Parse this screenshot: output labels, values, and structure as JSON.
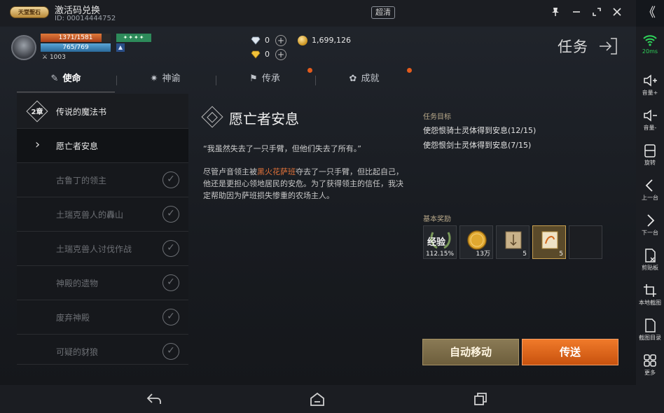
{
  "topbar": {
    "badge": "天堂聖石",
    "title": "激活码兑换",
    "id": "ID: 00014444752",
    "quality": "超清",
    "controls": [
      "pin-icon",
      "minimize-icon",
      "restore-icon",
      "close-icon"
    ],
    "collapse": "《"
  },
  "player": {
    "hp": "1371/1581",
    "hp_fraction": 0.867,
    "mp": "765/769",
    "mp_fraction": 0.995,
    "power": "1003",
    "power_icon": "crossed-swords-icon"
  },
  "currency": {
    "diamond_count": "0",
    "yellow_gem_count": "0",
    "gold": "1,699,126"
  },
  "screen_title": "任务",
  "tabs": [
    {
      "label": "使命",
      "icon": "quest-icon",
      "active": true
    },
    {
      "label": "神谕",
      "icon": "oracle-icon",
      "active": false
    },
    {
      "label": "传承",
      "icon": "flag-icon",
      "active": false
    },
    {
      "label": "成就",
      "icon": "achievement-icon",
      "active": false
    }
  ],
  "chapter": {
    "number": "2章",
    "label": "传说的魔法书"
  },
  "quests": [
    {
      "label": "愿亡者安息",
      "state": "current"
    },
    {
      "label": "古鲁丁的领主",
      "state": "done"
    },
    {
      "label": "土瑞克兽人的轟山",
      "state": "done"
    },
    {
      "label": "土瑞克兽人讨伐作战",
      "state": "done"
    },
    {
      "label": "神殿的遗物",
      "state": "done"
    },
    {
      "label": "废弃神殿",
      "state": "done"
    },
    {
      "label": "可疑的豺狼",
      "state": "done"
    }
  ],
  "detail": {
    "title": "愿亡者安息",
    "quote": "“我虽然失去了一只手臂，但他们失去了所有。”",
    "desc_before": "尽管卢音领主被",
    "desc_highlight": "黑火花萨班",
    "desc_after": "夺去了一只手臂，但比起自己，他还是更担心领地居民的安危。为了获得领主的信任，我决定帮助因为萨班损失惨重的农场主人。"
  },
  "objectives": {
    "header": "任务目标",
    "items": [
      "使怨恨骑士灵体得到安息(12/15)",
      "使怨恨剑士灵体得到安息(7/15)"
    ]
  },
  "rewards": {
    "header": "基本奖励",
    "items": [
      {
        "name": "经验",
        "count": "112.15%",
        "icon": "exp-laurel-icon"
      },
      {
        "name": "gold",
        "count": "13万",
        "icon": "gold-coin-icon"
      },
      {
        "name": "scroll",
        "count": "5",
        "icon": "teleport-scroll-icon"
      },
      {
        "name": "blessed-scroll",
        "count": "5",
        "icon": "blessed-scroll-icon"
      },
      {
        "name": "empty",
        "count": "",
        "icon": "empty-slot"
      }
    ]
  },
  "actions": {
    "auto_move": "自动移动",
    "teleport": "传送"
  },
  "sidebar": [
    {
      "label": "20ms",
      "icon": "wifi-icon"
    },
    {
      "label": "音量+",
      "icon": "volume-up-icon"
    },
    {
      "label": "音量-",
      "icon": "volume-down-icon"
    },
    {
      "label": "旋转",
      "icon": "rotate-icon"
    },
    {
      "label": "上一台",
      "icon": "prev-device-icon"
    },
    {
      "label": "下一台",
      "icon": "next-device-icon"
    },
    {
      "label": "剪贴板",
      "icon": "clipboard-icon"
    },
    {
      "label": "本地截图",
      "icon": "crop-icon"
    },
    {
      "label": "截图目录",
      "icon": "screenshot-folder-icon"
    },
    {
      "label": "更多",
      "icon": "more-grid-icon"
    }
  ],
  "navbar": [
    "back-icon",
    "home-icon",
    "recents-icon"
  ],
  "colors": {
    "accent": "#e35b1c",
    "highlight": "#e2733a",
    "wifi": "#2fd35a",
    "auto_button": "#7d6d48",
    "send_button": "#e26a1e"
  }
}
